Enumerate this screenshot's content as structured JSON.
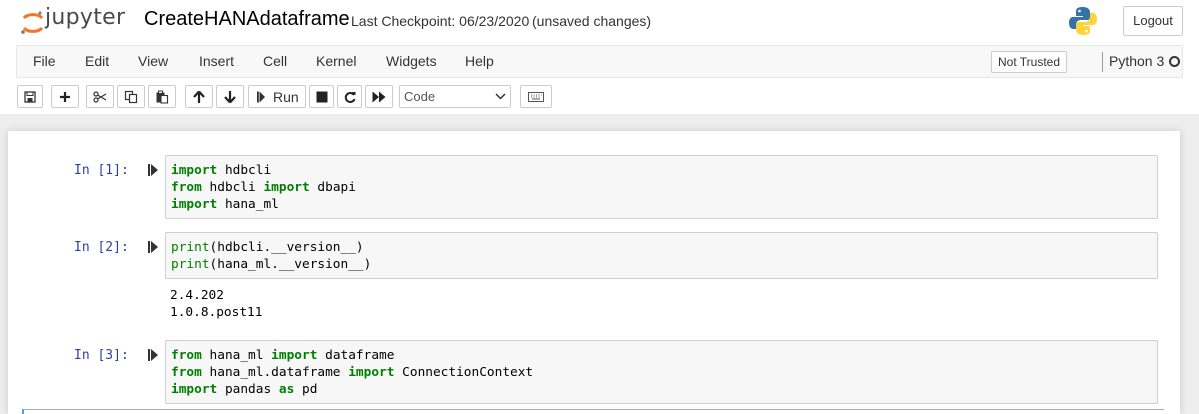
{
  "header": {
    "logo_text": "jupyter",
    "notebook_name": "CreateHANAdataframe",
    "checkpoint": "Last Checkpoint: 06/23/2020",
    "autosave_status": "(unsaved changes)",
    "logout_label": "Logout"
  },
  "menubar": {
    "items": [
      "File",
      "Edit",
      "View",
      "Insert",
      "Cell",
      "Kernel",
      "Widgets",
      "Help"
    ],
    "trust_label": "Not Trusted",
    "kernel_name": "Python 3"
  },
  "toolbar": {
    "buttons": [
      "save-icon",
      "plus-icon",
      "cut-icon",
      "copy-icon",
      "paste-icon",
      "arrow-up-icon",
      "arrow-down-icon",
      "run-icon",
      "stop-icon",
      "restart-icon",
      "fast-forward-icon",
      "keyboard-icon"
    ],
    "run_label": "Run",
    "cell_type": "Code"
  },
  "cells": [
    {
      "prompt": "In [1]:",
      "lines": [
        [
          [
            "kw",
            "import"
          ],
          [
            "t",
            " hdbcli"
          ]
        ],
        [
          [
            "kw",
            "from"
          ],
          [
            "t",
            " hdbcli "
          ],
          [
            "kw",
            "import"
          ],
          [
            "t",
            " dbapi"
          ]
        ],
        [
          [
            "kw",
            "import"
          ],
          [
            "t",
            " hana_ml"
          ]
        ]
      ],
      "output": []
    },
    {
      "prompt": "In [2]:",
      "lines": [
        [
          [
            "fn",
            "print"
          ],
          [
            "t",
            "(hdbcli.__version__)"
          ]
        ],
        [
          [
            "fn",
            "print"
          ],
          [
            "t",
            "(hana_ml.__version__)"
          ]
        ]
      ],
      "output": [
        "2.4.202",
        "1.0.8.post11"
      ]
    },
    {
      "prompt": "In [3]:",
      "lines": [
        [
          [
            "kw",
            "from"
          ],
          [
            "t",
            " hana_ml "
          ],
          [
            "kw",
            "import"
          ],
          [
            "t",
            " dataframe"
          ]
        ],
        [
          [
            "kw",
            "from"
          ],
          [
            "t",
            " hana_ml.dataframe "
          ],
          [
            "kw",
            "import"
          ],
          [
            "t",
            " ConnectionContext"
          ]
        ],
        [
          [
            "kw",
            "import"
          ],
          [
            "t",
            " pandas "
          ],
          [
            "kw",
            "as"
          ],
          [
            "t",
            " pd"
          ]
        ]
      ],
      "output": []
    }
  ],
  "colors": {
    "prompt": "#303F9F",
    "keyword": "#008000",
    "selected_cell_border": "#42A5F5",
    "logo_orange": "#F37726"
  }
}
